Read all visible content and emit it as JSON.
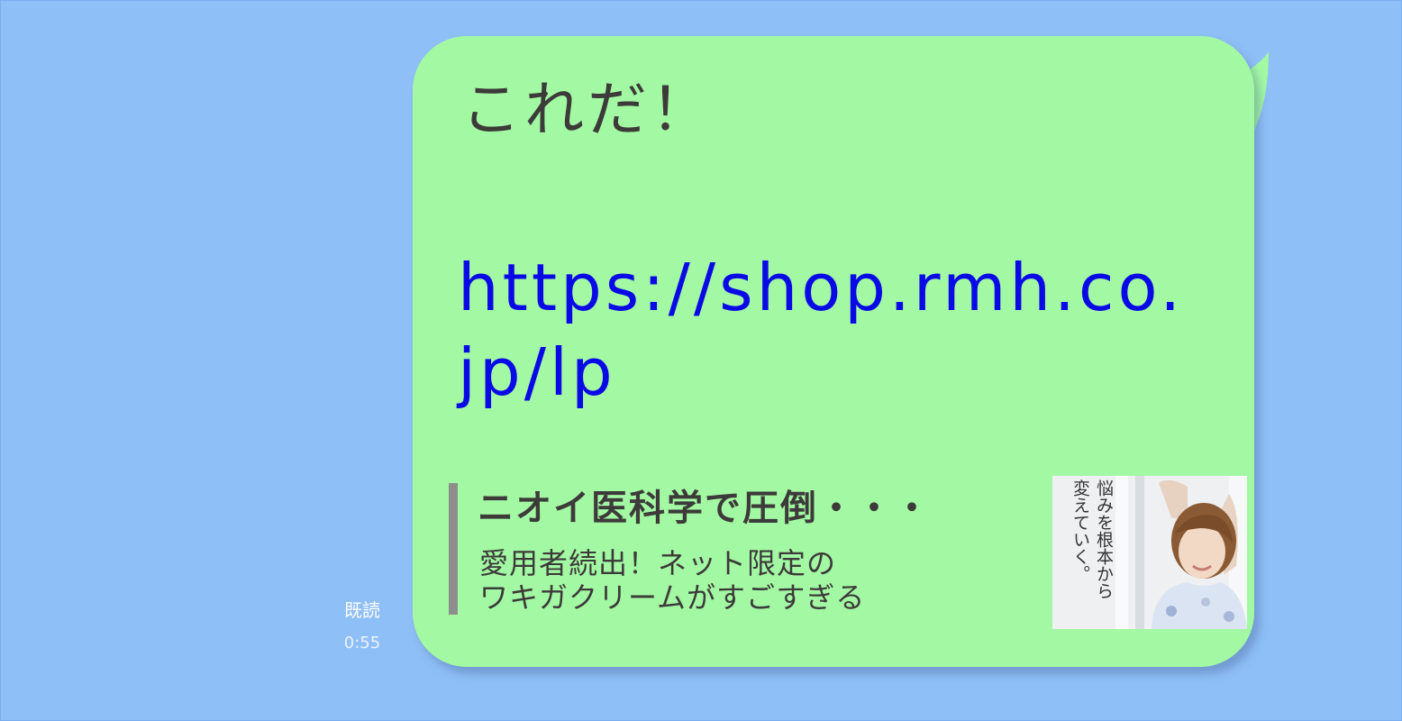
{
  "status": {
    "read_label": "既読",
    "time": "0:55"
  },
  "message": {
    "text": "これだ！",
    "link": "https://shop.rmh.co.jp/lp",
    "bubble_color": "#a3f9a3",
    "link_color": "#0a0ae6"
  },
  "preview": {
    "title": "ニオイ医科学で圧倒・・・",
    "description_lines": [
      "愛用者続出！ネット限定の",
      "ワキガクリームがすごすぎる"
    ],
    "thumbnail_caption_lines": [
      "悩みを根本から",
      "変えていく。"
    ]
  },
  "colors": {
    "background": "#8fbff7",
    "text": "#3d3a3a",
    "accent_bar": "#8e8e8e"
  }
}
